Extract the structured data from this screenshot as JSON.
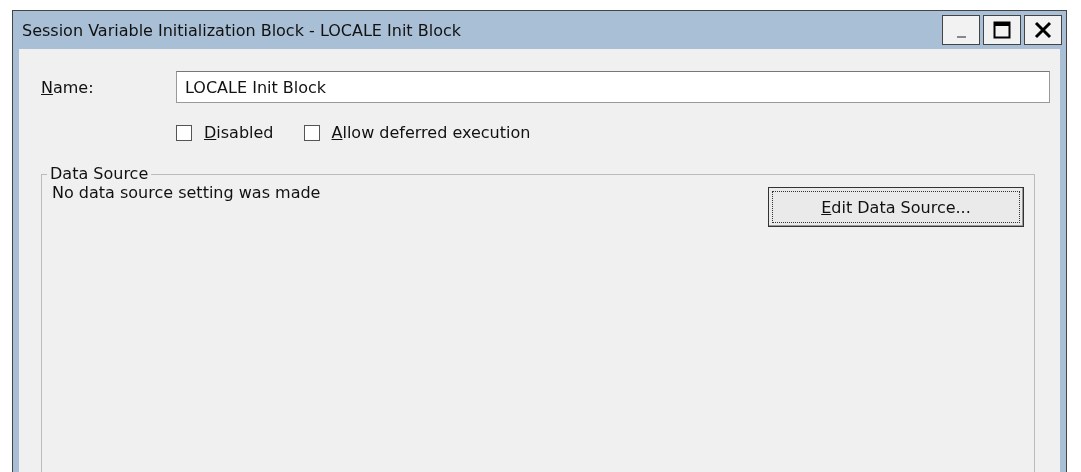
{
  "window": {
    "title": "Session Variable Initialization Block - LOCALE Init Block"
  },
  "name_field": {
    "label": "Name:",
    "underline_first": true,
    "value": "LOCALE Init Block"
  },
  "options": [
    {
      "label": "Disabled",
      "underline_first": true,
      "checked": false
    },
    {
      "label": "Allow deferred execution",
      "underline_first": true,
      "checked": false
    }
  ],
  "data_source": {
    "title": "Data Source",
    "status": "No data source setting was made",
    "button": {
      "label": "Edit Data Source...",
      "underline_first": true,
      "focused": true
    }
  }
}
